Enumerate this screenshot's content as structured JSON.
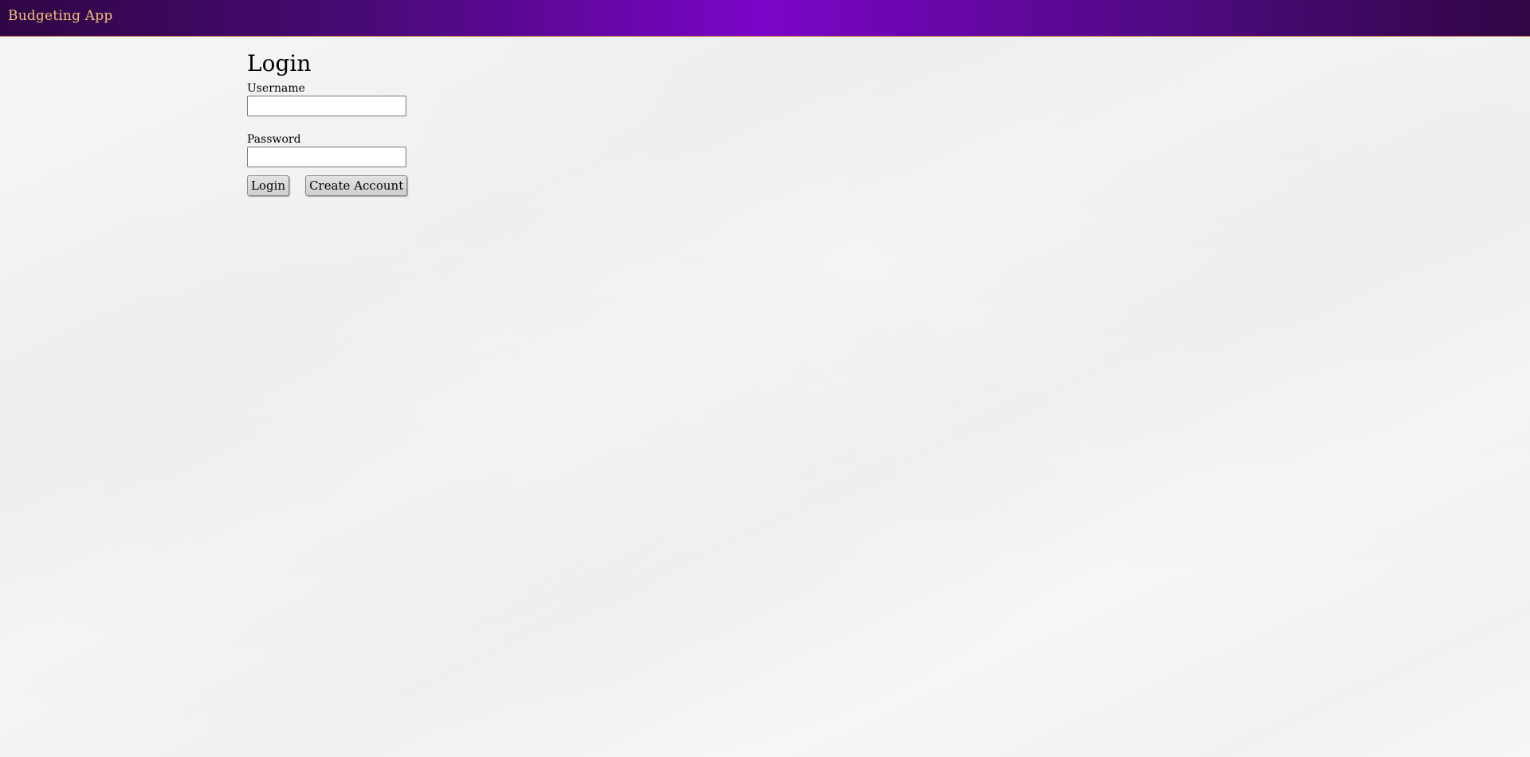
{
  "header": {
    "title": "Budgeting App"
  },
  "login": {
    "heading": "Login",
    "username_label": "Username",
    "username_value": "",
    "password_label": "Password",
    "password_value": "",
    "login_button": "Login",
    "create_account_button": "Create Account"
  },
  "colors": {
    "header_gradient_center": "#7b05c8",
    "header_gradient_edge": "#2f0645",
    "header_title": "#f0c27a",
    "header_border": "#c46a3a",
    "page_background": "#f6f6f6"
  }
}
